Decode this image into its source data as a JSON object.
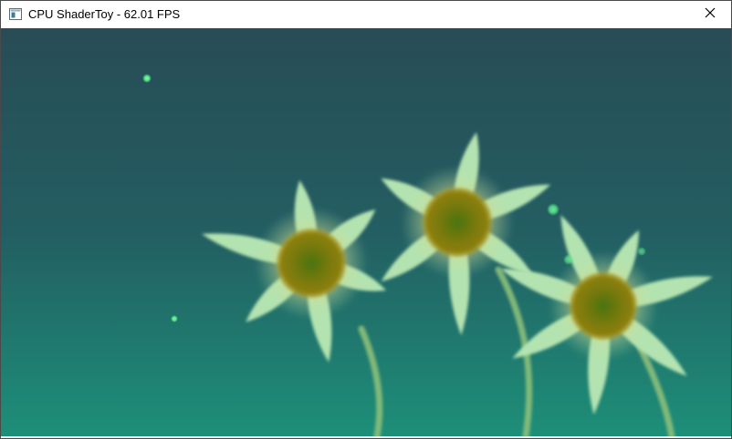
{
  "window": {
    "title": "CPU ShaderToy - 62.01 FPS",
    "icon": "app-window-icon",
    "close_icon": "close-icon"
  },
  "scene": {
    "description_colors": {
      "sky_top": "#284c56",
      "sky_bottom": "#1d8f78",
      "petal": "#b3e3b0",
      "petal_glow": "#e8de8a",
      "center_outer": "#857a0c",
      "center_inner": "#4f7a12",
      "stem": "#8cc07a",
      "firefly": "#5cf58c"
    },
    "flowers": [
      {
        "name": "left-flower"
      },
      {
        "name": "middle-flower"
      },
      {
        "name": "right-flower"
      }
    ]
  }
}
